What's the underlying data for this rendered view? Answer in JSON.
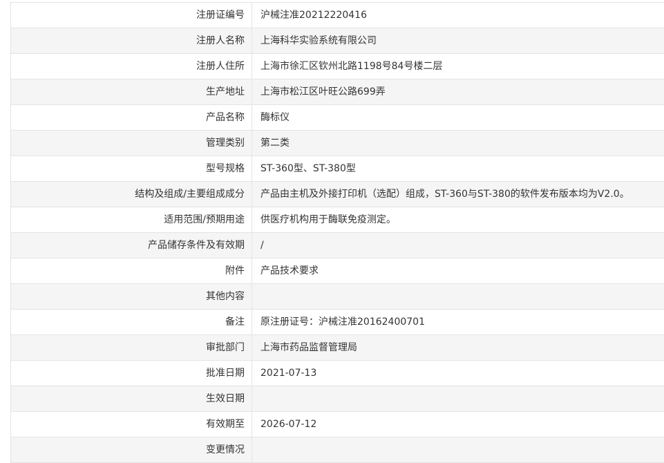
{
  "rows": [
    {
      "label": "注册证编号",
      "value": "沪械注准20212220416"
    },
    {
      "label": "注册人名称",
      "value": "上海科华实验系统有限公司"
    },
    {
      "label": "注册人住所",
      "value": "上海市徐汇区钦州北路1198号84号楼二层"
    },
    {
      "label": "生产地址",
      "value": "上海市松江区叶旺公路699弄"
    },
    {
      "label": "产品名称",
      "value": "酶标仪"
    },
    {
      "label": "管理类别",
      "value": "第二类"
    },
    {
      "label": "型号规格",
      "value": "ST-360型、ST-380型"
    },
    {
      "label": "结构及组成/主要组成成分",
      "value": "产品由主机及外接打印机（选配）组成，ST-360与ST-380的软件发布版本均为V2.0。"
    },
    {
      "label": "适用范围/预期用途",
      "value": "供医疗机构用于酶联免疫测定。"
    },
    {
      "label": "产品储存条件及有效期",
      "value": "/"
    },
    {
      "label": "附件",
      "value": "产品技术要求"
    },
    {
      "label": "其他内容",
      "value": ""
    },
    {
      "label": "备注",
      "value": "原注册证号：沪械注准20162400701"
    },
    {
      "label": "审批部门",
      "value": "上海市药品监督管理局"
    },
    {
      "label": "批准日期",
      "value": "2021-07-13"
    },
    {
      "label": "生效日期",
      "value": ""
    },
    {
      "label": "有效期至",
      "value": "2026-07-12"
    },
    {
      "label": "变更情况",
      "value": ""
    }
  ]
}
